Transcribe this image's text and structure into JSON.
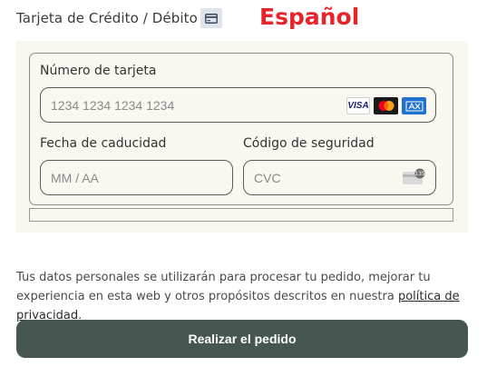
{
  "payment_method": {
    "title": "Tarjeta de Crédito / Débito",
    "icon": "credit-card-icon"
  },
  "language_label": "Español",
  "card_form": {
    "card_number": {
      "label": "Número de tarjeta",
      "placeholder": "1234 1234 1234 1234",
      "brands": [
        "VISA",
        "Mastercard",
        "American Express"
      ],
      "visa_text": "VISA"
    },
    "expiry": {
      "label": "Fecha de caducidad",
      "placeholder": "MM / AA"
    },
    "cvc": {
      "label": "Código de seguridad",
      "placeholder": "CVC",
      "icon": "cvc-card-icon",
      "badge": "135"
    }
  },
  "privacy": {
    "text_before": "Tus datos personales se utilizarán para procesar tu pedido, mejorar tu experiencia en esta web y otros propósitos descritos en nuestra ",
    "link_text": "política de privacidad",
    "text_after": "."
  },
  "order_button_label": "Realizar el pedido",
  "colors": {
    "accent_red": "#e8242b",
    "button_bg": "#465651",
    "panel_bg": "#faf6f0"
  }
}
